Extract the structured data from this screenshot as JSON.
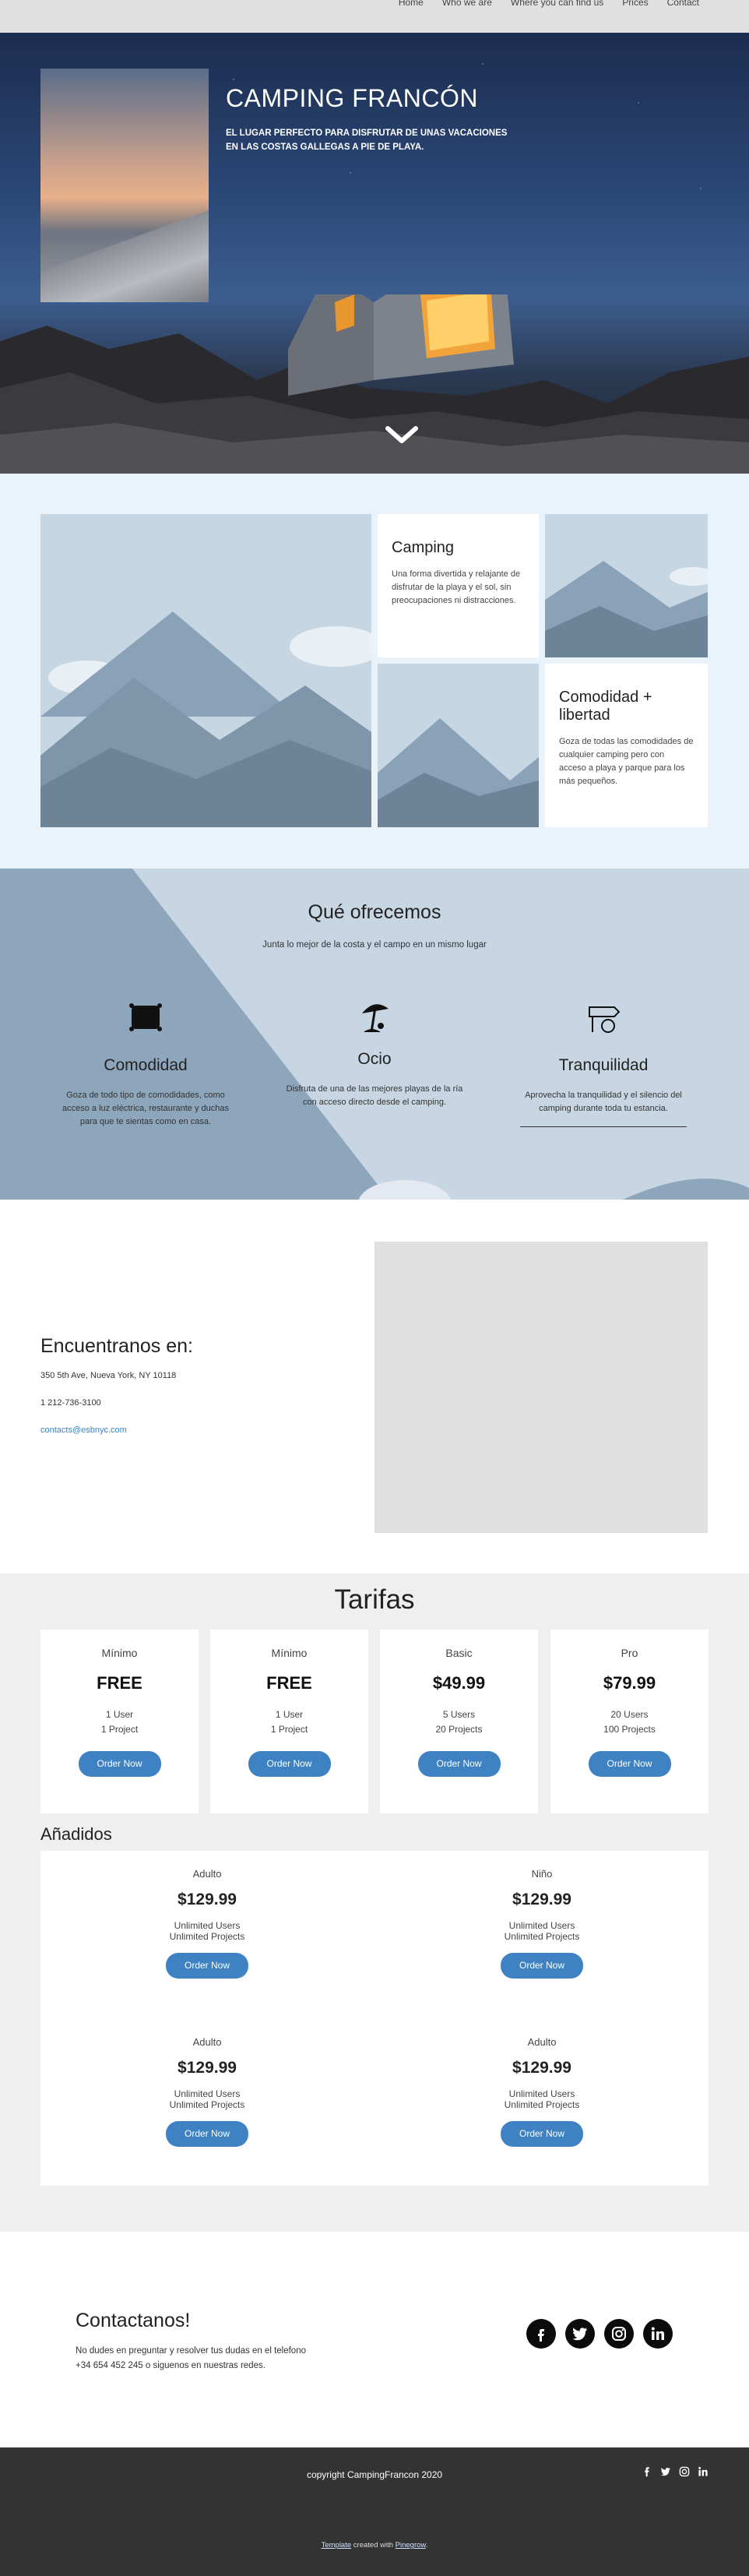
{
  "nav": {
    "items": [
      "Home",
      "Who we are",
      "Where you can find us",
      "Prices",
      "Contact"
    ]
  },
  "hero": {
    "title": "CAMPING FRANCÓN",
    "subtitle": "EL LUGAR PERFECTO PARA DISFRUTAR DE UNAS VACACIONES EN LAS COSTAS GALLEGAS A PIE DE PLAYA."
  },
  "gallery": {
    "camping": {
      "title": "Camping",
      "text": "Una forma divertida y relajante de disfrutar de la playa y el sol, sin preocupaciones ni distracciones."
    },
    "comodidad": {
      "title": "Comodidad + libertad",
      "text": "Goza de todas las comodidades de cualquier camping pero con acceso a playa y parque para los más pequeños."
    }
  },
  "offer": {
    "title": "Qué ofrecemos",
    "lead": "Junta lo mejor de la costa y el campo en un mismo lugar",
    "features": [
      {
        "title": "Comodidad",
        "text": "Goza de todo tipo de comodidades, como acceso a luz eléctrica, restaurante y duchas para que te sientas como en casa."
      },
      {
        "title": "Ocio",
        "text": "Disfruta de una de las mejores playas de la ría con acceso directo desde el camping."
      },
      {
        "title": "Tranquilidad",
        "text": "Aprovecha la tranquilidad y el silencio del camping durante toda tu estancia."
      }
    ]
  },
  "contact": {
    "title": "Encuentranos en:",
    "address": "350 5th Ave, Nueva York, NY 10118",
    "phone": "1 212-736-3100",
    "email": "contacts@esbnyc.com"
  },
  "pricing": {
    "title": "Tarifas",
    "order_label": "Order Now",
    "plans": [
      {
        "name": "Mínimo",
        "price": "FREE",
        "line1": "1 User",
        "line2": "1 Project"
      },
      {
        "name": "Mínimo",
        "price": "FREE",
        "line1": "1 User",
        "line2": "1 Project"
      },
      {
        "name": "Basic",
        "price": "$49.99",
        "line1": "5 Users",
        "line2": "20 Projects"
      },
      {
        "name": "Pro",
        "price": "$79.99",
        "line1": "20 Users",
        "line2": "100 Projects"
      }
    ],
    "addons_title": "Añadidos",
    "addons": [
      {
        "name": "Adulto",
        "price": "$129.99",
        "line1": "Unlimited Users",
        "line2": "Unlimited Projects"
      },
      {
        "name": "Niño",
        "price": "$129.99",
        "line1": "Unlimited Users",
        "line2": "Unlimited Projects"
      },
      {
        "name": "Adulto",
        "price": "$129.99",
        "line1": "Unlimited Users",
        "line2": "Unlimited Projects"
      },
      {
        "name": "Adulto",
        "price": "$129.99",
        "line1": "Unlimited Users",
        "line2": "Unlimited Projects"
      }
    ]
  },
  "contactanos": {
    "title": "Contactanos!",
    "line1": "No dudes en preguntar y resolver tus dudas en el telefono",
    "line2": "+34 654 452 245 o siguenos en nuestras redes."
  },
  "footer": {
    "copyright": "copyright CampingFrancon 2020",
    "credit_link1": "Template",
    "credit_mid": " created with ",
    "credit_link2": "Pinegrow",
    "credit_end": "."
  },
  "icons": [
    "facebook-icon",
    "twitter-icon",
    "instagram-icon",
    "linkedin-icon",
    "chevron-down-icon",
    "tent-icon",
    "beach-umbrella-icon",
    "sign-icon"
  ],
  "colors": {
    "accent": "#3e82c4",
    "offer_bg": "#c7d6e2",
    "gallery_bg": "#eaf2fa",
    "footer_bg": "#333333"
  }
}
